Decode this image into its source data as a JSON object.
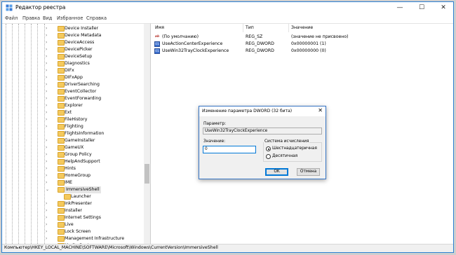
{
  "window": {
    "title": "Редактор реестра"
  },
  "controls": {
    "minimize": "—",
    "maximize": "☐",
    "close": "✕"
  },
  "menu": {
    "items": [
      "Файл",
      "Правка",
      "Вид",
      "Избранное",
      "Справка"
    ]
  },
  "tree": {
    "items": [
      {
        "label": "Device Installer",
        "expander": "›"
      },
      {
        "label": "Device Metadata",
        "expander": "›"
      },
      {
        "label": "DeviceAccess",
        "expander": "›"
      },
      {
        "label": "DevicePicker",
        "expander": "›"
      },
      {
        "label": "DeviceSetup",
        "expander": "›"
      },
      {
        "label": "Diagnostics",
        "expander": "›"
      },
      {
        "label": "DIFx",
        "expander": "›"
      },
      {
        "label": "DIFxApp",
        "expander": "›"
      },
      {
        "label": "DriverSearching",
        "expander": "›"
      },
      {
        "label": "EventCollector",
        "expander": "›"
      },
      {
        "label": "EventForwarding",
        "expander": "›"
      },
      {
        "label": "Explorer",
        "expander": "›"
      },
      {
        "label": "Ext",
        "expander": "›"
      },
      {
        "label": "FileHistory",
        "expander": "›"
      },
      {
        "label": "Flighting",
        "expander": "›"
      },
      {
        "label": "FlightsInformation",
        "expander": ""
      },
      {
        "label": "GameInstaller",
        "expander": "›"
      },
      {
        "label": "GameUX",
        "expander": "›"
      },
      {
        "label": "Group Policy",
        "expander": "›"
      },
      {
        "label": "HelpAndSupport",
        "expander": "›"
      },
      {
        "label": "Hints",
        "expander": "›"
      },
      {
        "label": "HomeGroup",
        "expander": "›"
      },
      {
        "label": "IME",
        "expander": "›"
      },
      {
        "label": "ImmersiveShell",
        "expander": "⌄",
        "selected": true
      },
      {
        "label": "Launcher",
        "expander": "",
        "child": true
      },
      {
        "label": "InkPresenter",
        "expander": "›"
      },
      {
        "label": "Installer",
        "expander": "›"
      },
      {
        "label": "Internet Settings",
        "expander": "›"
      },
      {
        "label": "Live",
        "expander": "›"
      },
      {
        "label": "Lock Screen",
        "expander": "›"
      },
      {
        "label": "Management Infrastructure",
        "expander": "›"
      },
      {
        "label": "Media Center",
        "expander": "›"
      }
    ]
  },
  "values_list": {
    "headers": {
      "name": "Имя",
      "type": "Тип",
      "value": "Значение"
    },
    "rows": [
      {
        "icon": "string-value-icon",
        "glyph": "ab",
        "name": "(По умолчанию)",
        "type": "REG_SZ",
        "data": "(значение не присвоено)"
      },
      {
        "icon": "binary-value-icon",
        "glyph": "01",
        "name": "UseActionCenterExperience",
        "type": "REG_DWORD",
        "data": "0x00000001 (1)"
      },
      {
        "icon": "binary-value-icon",
        "glyph": "01",
        "name": "UseWin32TrayClockExperience",
        "type": "REG_DWORD",
        "data": "0x00000000 (0)"
      }
    ]
  },
  "status": {
    "path": "Компьютер\\HKEY_LOCAL_MACHINE\\SOFTWARE\\Microsoft\\Windows\\CurrentVersion\\ImmersiveShell"
  },
  "dialog": {
    "title": "Изменение параметра DWORD (32 бита)",
    "close": "✕",
    "param_label": "Параметр:",
    "param_value": "UseWin32TrayClockExperience",
    "value_label": "Значение:",
    "value_input": "0",
    "base_label": "Система исчисления",
    "base_options": [
      {
        "label": "Шестнадцатеричная",
        "selected": true
      },
      {
        "label": "Десятичная",
        "selected": false
      }
    ],
    "ok_label": "OK",
    "cancel_label": "Отмена"
  }
}
